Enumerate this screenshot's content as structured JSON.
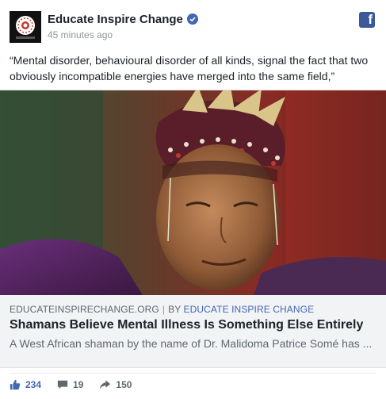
{
  "post": {
    "page_name": "Educate Inspire Change",
    "timestamp": "45 minutes ago",
    "text": "“Mental disorder, behavioural disorder of all kinds, signal the fact that two obviously incompatible energies have merged into the same field,”"
  },
  "link": {
    "domain": "EDUCATEINSPIRECHANGE.ORG",
    "separator": "|",
    "by_label": "BY",
    "by_name": "EDUCATE INSPIRE CHANGE",
    "title": "Shamans Believe Mental Illness Is Something Else Entirely",
    "description": "A West African shaman by the name of Dr. Malidoma Patrice Somé has ..."
  },
  "stats": {
    "likes": "234",
    "comments": "19",
    "shares": "150"
  },
  "icons": {
    "verified": "verified-badge-icon",
    "facebook": "facebook-logo-icon",
    "like": "thumbs-up-icon",
    "comment": "comment-bubble-icon",
    "share": "share-arrow-icon"
  },
  "colors": {
    "accent": "#4267b2",
    "facebook_blue": "#3b5998",
    "muted_text": "#90949c",
    "meta_background": "#f2f3f5"
  }
}
